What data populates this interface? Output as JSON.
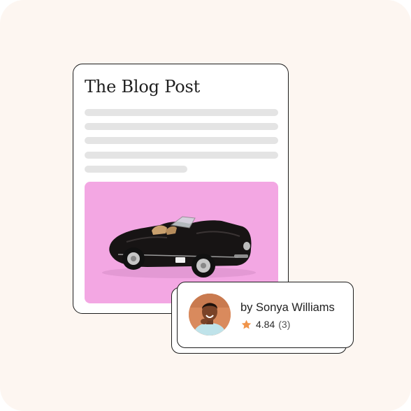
{
  "blog": {
    "title": "The Blog Post",
    "image": {
      "subject": "car-icon",
      "background_color": "#f3a7e3"
    }
  },
  "author": {
    "byline": "by Sonya Williams",
    "rating": "4.84",
    "review_count": "(3)",
    "avatar": "avatar-icon"
  },
  "icons": {
    "rating": "star-icon"
  },
  "colors": {
    "page_background": "#fdf6f1",
    "card_border": "#1c1c1c",
    "skeleton": "#e4e4e4",
    "star": "#f0944a"
  }
}
